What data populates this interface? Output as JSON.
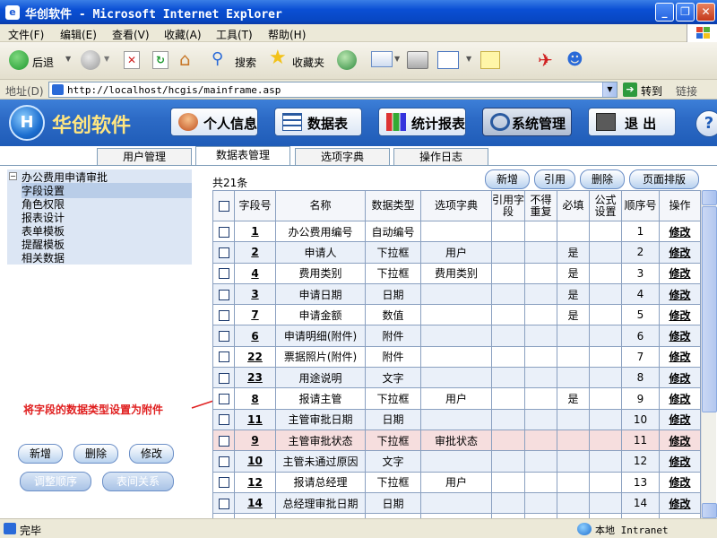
{
  "window": {
    "title": "华创软件 - Microsoft Internet Explorer"
  },
  "menu": [
    "文件(F)",
    "编辑(E)",
    "查看(V)",
    "收藏(A)",
    "工具(T)",
    "帮助(H)"
  ],
  "toolbar": {
    "back": "后退",
    "search": "搜索",
    "favorites": "收藏夹"
  },
  "address": {
    "label": "地址(D)",
    "url": "http://localhost/hcgis/mainframe.asp",
    "go": "转到",
    "links": "链接"
  },
  "app": {
    "brand": "华创软件",
    "nav": [
      "个人信息",
      "数据表",
      "统计报表",
      "系统管理",
      "退 出"
    ]
  },
  "tabs": [
    "用户管理",
    "数据表管理",
    "选项字典",
    "操作日志"
  ],
  "tree": {
    "root": "办公费用申请审批",
    "items": [
      "字段设置",
      "角色权限",
      "报表设计",
      "表单模板",
      "提醒模板",
      "相关数据"
    ]
  },
  "left_buttons": [
    "新增",
    "删除",
    "修改",
    "调整顺序",
    "表间关系"
  ],
  "annotation": "将字段的数据类型设置为附件",
  "count": "共21条",
  "actions": [
    "新增",
    "引用",
    "删除",
    "页面排版"
  ],
  "columns": [
    "字段号",
    "名称",
    "数据类型",
    "选项字典",
    "引用字段",
    "不得重复",
    "必填",
    "公式设置",
    "顺序号",
    "操作"
  ],
  "rows": [
    {
      "id": "1",
      "name": "办公费用编号",
      "type": "自动编号",
      "dict": "",
      "req": "",
      "order": "1"
    },
    {
      "id": "2",
      "name": "申请人",
      "type": "下拉框",
      "dict": "用户",
      "req": "是",
      "order": "2"
    },
    {
      "id": "4",
      "name": "费用类别",
      "type": "下拉框",
      "dict": "费用类别",
      "req": "是",
      "order": "3"
    },
    {
      "id": "3",
      "name": "申请日期",
      "type": "日期",
      "dict": "",
      "req": "是",
      "order": "4"
    },
    {
      "id": "7",
      "name": "申请金额",
      "type": "数值",
      "dict": "",
      "req": "是",
      "order": "5"
    },
    {
      "id": "6",
      "name": "申请明细(附件)",
      "type": "附件",
      "dict": "",
      "req": "",
      "order": "6"
    },
    {
      "id": "22",
      "name": "票据照片(附件)",
      "type": "附件",
      "dict": "",
      "req": "",
      "order": "7"
    },
    {
      "id": "23",
      "name": "用途说明",
      "type": "文字",
      "dict": "",
      "req": "",
      "order": "8"
    },
    {
      "id": "8",
      "name": "报请主管",
      "type": "下拉框",
      "dict": "用户",
      "req": "是",
      "order": "9"
    },
    {
      "id": "11",
      "name": "主管审批日期",
      "type": "日期",
      "dict": "",
      "req": "",
      "order": "10"
    },
    {
      "id": "9",
      "name": "主管审批状态",
      "type": "下拉框",
      "dict": "审批状态",
      "req": "",
      "order": "11"
    },
    {
      "id": "10",
      "name": "主管未通过原因",
      "type": "文字",
      "dict": "",
      "req": "",
      "order": "12"
    },
    {
      "id": "12",
      "name": "报请总经理",
      "type": "下拉框",
      "dict": "用户",
      "req": "",
      "order": "13"
    },
    {
      "id": "14",
      "name": "总经理审批日期",
      "type": "日期",
      "dict": "",
      "req": "",
      "order": "14"
    },
    {
      "id": "",
      "name": "",
      "type": "",
      "dict": "",
      "req": "",
      "order": ""
    }
  ],
  "edit_label": "修改",
  "status": {
    "text": "完毕",
    "zone": "本地 Intranet"
  }
}
